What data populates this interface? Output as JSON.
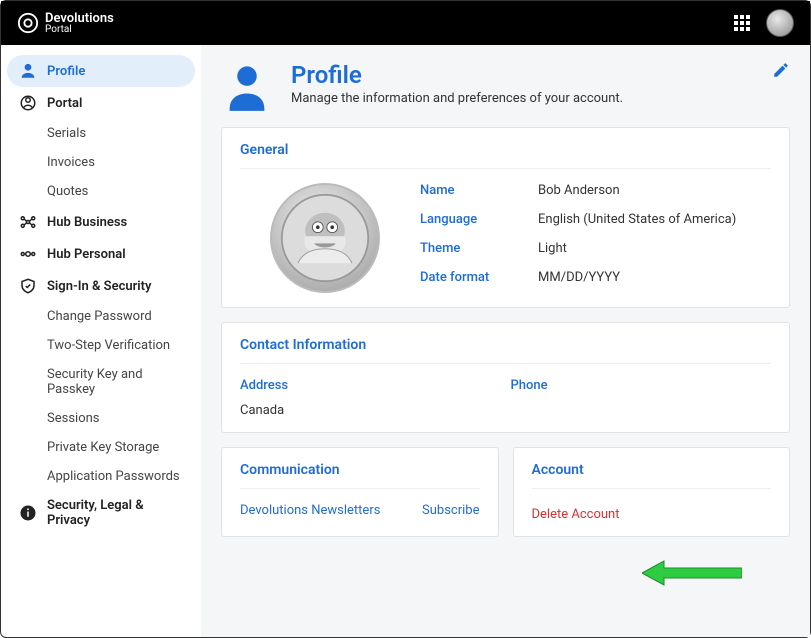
{
  "brand": {
    "name": "Devolutions",
    "sub": "Portal"
  },
  "sidebar": {
    "items": [
      {
        "label": "Profile"
      },
      {
        "label": "Portal"
      },
      {
        "label": "Serials"
      },
      {
        "label": "Invoices"
      },
      {
        "label": "Quotes"
      },
      {
        "label": "Hub Business"
      },
      {
        "label": "Hub Personal"
      },
      {
        "label": "Sign-In & Security"
      },
      {
        "label": "Change Password"
      },
      {
        "label": "Two-Step Verification"
      },
      {
        "label": "Security Key and Passkey"
      },
      {
        "label": "Sessions"
      },
      {
        "label": "Private Key Storage"
      },
      {
        "label": "Application Passwords"
      },
      {
        "label": "Security, Legal & Privacy"
      }
    ]
  },
  "page": {
    "title": "Profile",
    "subtitle": "Manage the information and preferences of your account."
  },
  "general": {
    "heading": "General",
    "fields": {
      "name_label": "Name",
      "name_value": "Bob Anderson",
      "language_label": "Language",
      "language_value": "English (United States of America)",
      "theme_label": "Theme",
      "theme_value": "Light",
      "dateformat_label": "Date format",
      "dateformat_value": "MM/DD/YYYY"
    }
  },
  "contact": {
    "heading": "Contact Information",
    "address_label": "Address",
    "address_value": "Canada",
    "phone_label": "Phone",
    "phone_value": ""
  },
  "communication": {
    "heading": "Communication",
    "item_label": "Devolutions Newsletters",
    "action": "Subscribe"
  },
  "account": {
    "heading": "Account",
    "delete_label": "Delete Account"
  }
}
